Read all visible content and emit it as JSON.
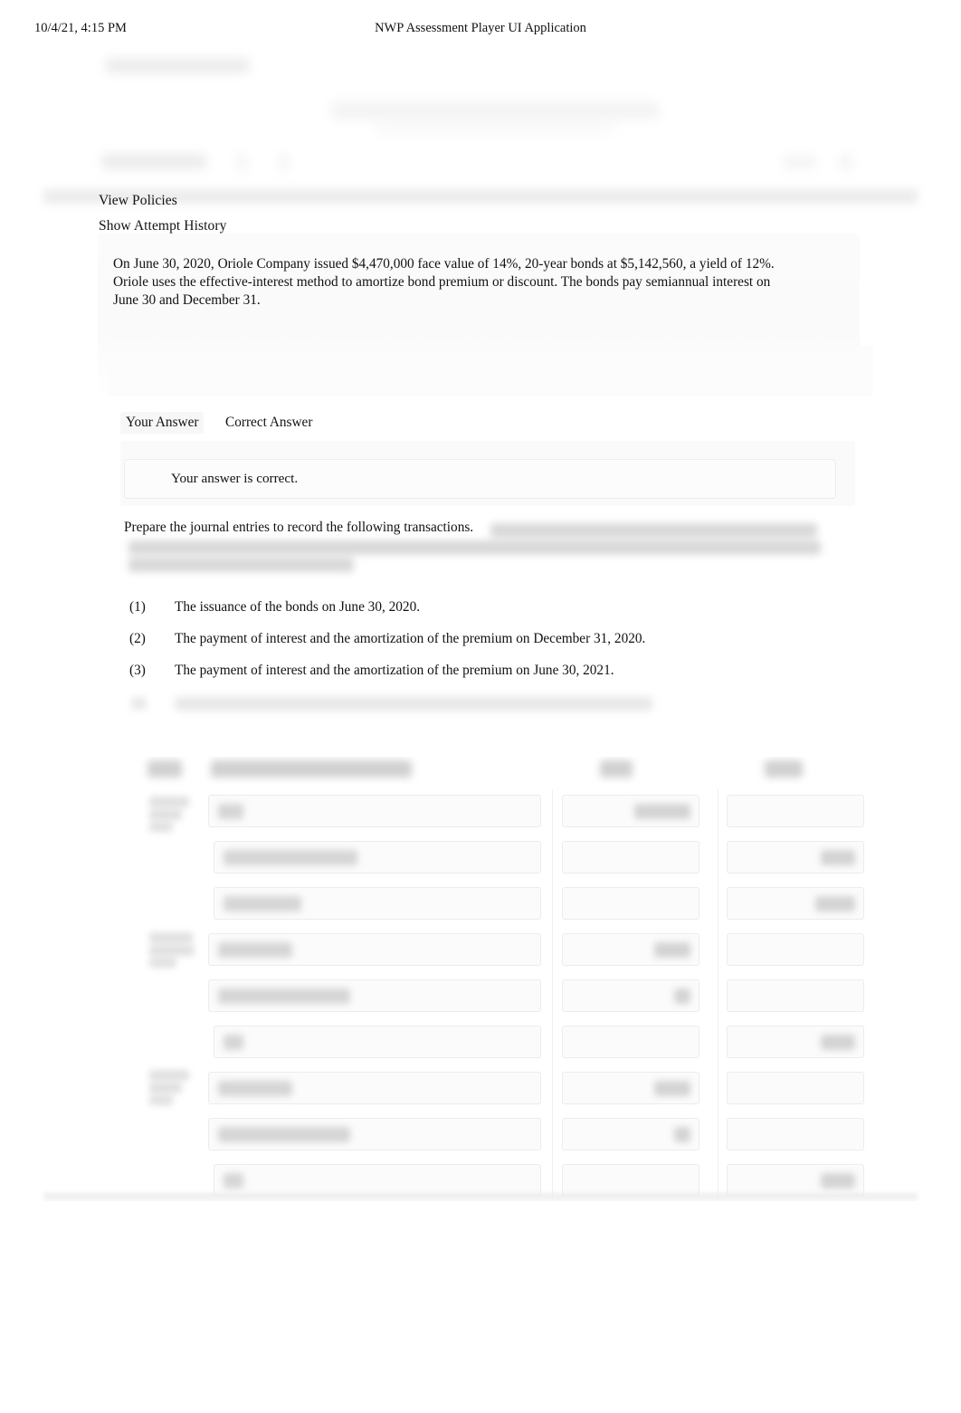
{
  "print_header": {
    "date": "10/4/21, 4:15 PM",
    "title": "NWP Assessment Player UI Application"
  },
  "links": {
    "view_policies": "View Policies",
    "show_attempt_history": "Show Attempt History"
  },
  "question": {
    "text": "On June 30, 2020, Oriole Company issued $4,470,000 face value of 14%, 20-year bonds at $5,142,560, a yield of 12%. Oriole uses the effective-interest method to amortize bond premium or discount. The bonds pay semiannual interest on June 30 and December 31."
  },
  "tabs": [
    {
      "label": "Your Answer",
      "selected": true
    },
    {
      "label": "Correct Answer",
      "selected": false
    }
  ],
  "alert": {
    "icon": "check-circle-icon",
    "glyph": " ",
    "message": "Your answer is correct."
  },
  "instruction": "Prepare the journal entries to record the following transactions.",
  "transactions": [
    {
      "num": "(1)",
      "text": "The issuance of the bonds on June 30, 2020."
    },
    {
      "num": "(2)",
      "text": "The payment of interest and the amortization of the premium on December 31, 2020."
    },
    {
      "num": "(3)",
      "text": "The payment of interest and the amortization of the premium on June 30, 2021."
    },
    {
      "num": "",
      "text": ""
    }
  ],
  "journal_table": {
    "columns": [
      "Date",
      "Account Titles and Explanation",
      "Debit",
      "Credit"
    ],
    "rows": [
      {
        "date": "",
        "account": "",
        "indent": false,
        "debit": true,
        "credit": false
      },
      {
        "date": "",
        "account": "",
        "indent": true,
        "debit": false,
        "credit": true
      },
      {
        "date": "",
        "account": "",
        "indent": true,
        "debit": false,
        "credit": true
      },
      {
        "date": "",
        "account": "",
        "indent": false,
        "debit": true,
        "credit": false
      },
      {
        "date": "",
        "account": "",
        "indent": false,
        "debit": true,
        "credit": false
      },
      {
        "date": "",
        "account": "",
        "indent": true,
        "debit": false,
        "credit": true
      },
      {
        "date": "",
        "account": "",
        "indent": false,
        "debit": true,
        "credit": false
      },
      {
        "date": "",
        "account": "",
        "indent": false,
        "debit": true,
        "credit": false
      },
      {
        "date": "",
        "account": "",
        "indent": true,
        "debit": false,
        "credit": true
      }
    ]
  },
  "colors": {
    "page_background": "#ffffff",
    "text": "#1a1a1a",
    "panel_background": "#fafafa",
    "input_background": "#fbfbfb",
    "input_border": "#ececed",
    "blur_gray": "#9a9a9a"
  }
}
